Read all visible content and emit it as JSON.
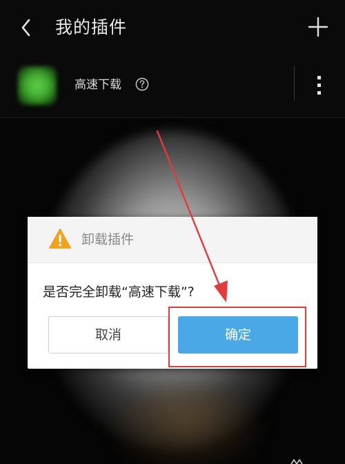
{
  "header": {
    "title": "我的插件",
    "back_icon": "chevron-left-icon",
    "add_icon": "plus-icon"
  },
  "plugin": {
    "name": "高速下载",
    "icon": "plugin-app-icon",
    "help_icon": "question-circle-icon",
    "more_icon": "more-vertical-icon"
  },
  "dialog": {
    "title": "卸载插件",
    "warning_icon": "warning-triangle-icon",
    "message": "是否完全卸载“高速下载”?",
    "cancel_label": "取消",
    "confirm_label": "确定"
  },
  "colors": {
    "confirm_button": "#4aa8e6",
    "warning_icon": "#f4a11c",
    "annotation": "#e23b3b",
    "background": "#050505"
  }
}
